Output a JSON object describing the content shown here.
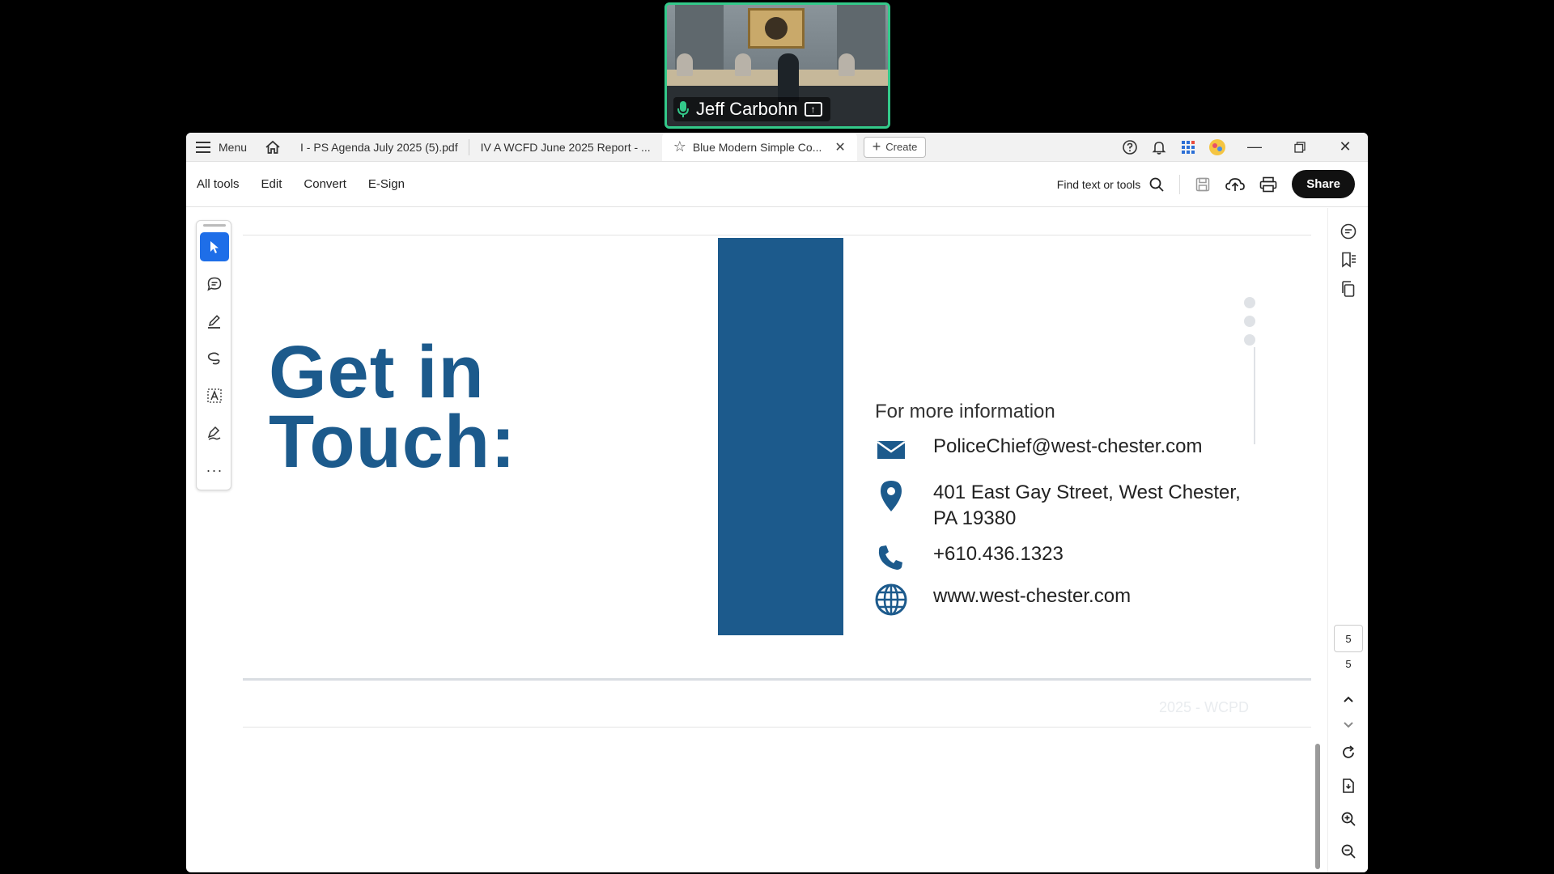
{
  "video": {
    "participant_name": "Jeff Carbohn"
  },
  "tabbar": {
    "menu_label": "Menu",
    "tabs": [
      {
        "label": "I - PS Agenda July 2025 (5).pdf"
      },
      {
        "label": "IV A WCFD June 2025 Report - ..."
      },
      {
        "label": "Blue Modern Simple Co..."
      }
    ],
    "create_label": "Create"
  },
  "toolbar": {
    "items": [
      "All tools",
      "Edit",
      "Convert",
      "E-Sign"
    ],
    "find_label": "Find text or tools",
    "share_label": "Share"
  },
  "document": {
    "headline_line1": "Get in",
    "headline_line2": "Touch:",
    "more_info": "For more information",
    "email": "PoliceChief@west-chester.com",
    "address_line1": "401 East Gay Street, West Chester,",
    "address_line2": "PA 19380",
    "phone": "+610.436.1323",
    "website": "www.west-chester.com",
    "footer": "2025 -  WCPD",
    "accent_color": "#1c5a8c"
  },
  "pager": {
    "current_page": "5",
    "total_pages": "5"
  }
}
